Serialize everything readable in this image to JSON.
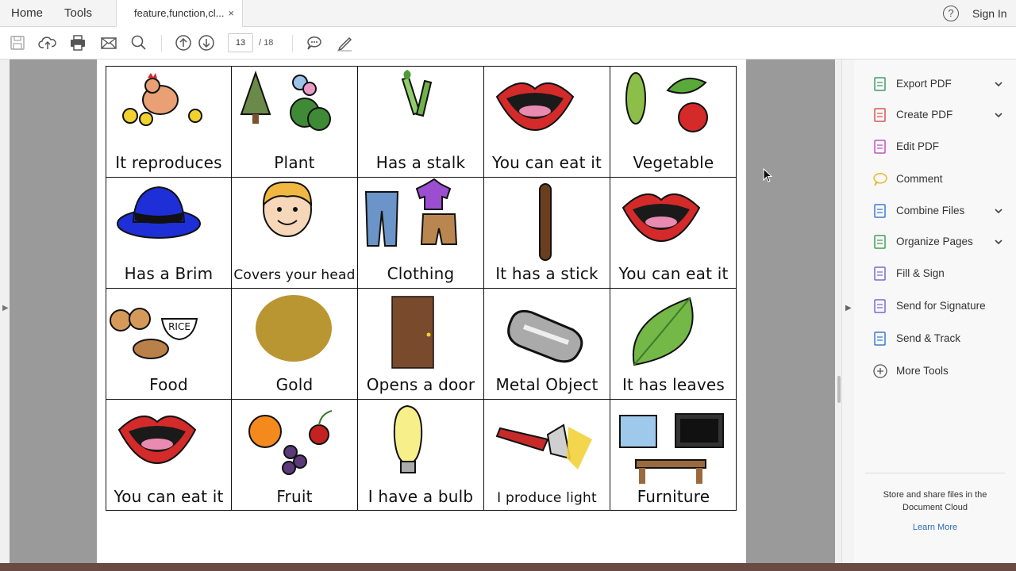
{
  "topbar": {
    "home_label": "Home",
    "tools_label": "Tools",
    "tab_title": "feature,function,cl...",
    "tab_close": "×",
    "help_glyph": "?",
    "signin_label": "Sign In"
  },
  "toolbar": {
    "current_page": "13",
    "total_pages": "/ 18",
    "icons": [
      "save-icon",
      "upload-icon",
      "print-icon",
      "email-icon",
      "search-icon",
      "previous-page-icon",
      "next-page-icon",
      "comment-icon",
      "sign-icon"
    ]
  },
  "cards": [
    {
      "label": "It reproduces",
      "picture": "hen-and-chicks"
    },
    {
      "label": "Plant",
      "picture": "tree-flower-bush"
    },
    {
      "label": "Has a stalk",
      "picture": "celery"
    },
    {
      "label": "You can eat it",
      "picture": "mouth"
    },
    {
      "label": "Vegetable",
      "picture": "corn-peas-tomato"
    },
    {
      "label": "Has a Brim",
      "picture": "blue-hat"
    },
    {
      "label": "Covers your head",
      "picture": "hair"
    },
    {
      "label": "Clothing",
      "picture": "clothes"
    },
    {
      "label": "It has a stick",
      "picture": "stick"
    },
    {
      "label": "You can eat it",
      "picture": "mouth"
    },
    {
      "label": "Food",
      "picture": "cookies-rice-chicken"
    },
    {
      "label": "Gold",
      "picture": "gold-oval"
    },
    {
      "label": "Opens a door",
      "picture": "door"
    },
    {
      "label": "Metal Object",
      "picture": "dog-tags"
    },
    {
      "label": "It has leaves",
      "picture": "leaf"
    },
    {
      "label": "You can eat it",
      "picture": "mouth"
    },
    {
      "label": "Fruit",
      "picture": "orange-grapes-cherry"
    },
    {
      "label": "I have a bulb",
      "picture": "light-bulb"
    },
    {
      "label": "I produce light",
      "picture": "flashlight"
    },
    {
      "label": "Furniture",
      "picture": "chair-tv-table"
    }
  ],
  "rice_text": "RICE",
  "right_panel": {
    "tools": [
      {
        "label": "Export PDF",
        "icon": "export-pdf-icon",
        "color": "#3f9e63"
      },
      {
        "label": "Create PDF",
        "icon": "create-pdf-icon",
        "color": "#d9534f"
      },
      {
        "label": "Edit PDF",
        "icon": "edit-pdf-icon",
        "color": "#c254c1"
      },
      {
        "label": "Comment",
        "icon": "comment-icon",
        "color": "#e8b92e"
      },
      {
        "label": "Combine Files",
        "icon": "combine-files-icon",
        "color": "#3a7bd5"
      },
      {
        "label": "Organize Pages",
        "icon": "organize-pages-icon",
        "color": "#3fa34d"
      },
      {
        "label": "Fill & Sign",
        "icon": "fill-sign-icon",
        "color": "#7b68d6"
      },
      {
        "label": "Send for Signature",
        "icon": "send-signature-icon",
        "color": "#7b68d6"
      },
      {
        "label": "Send & Track",
        "icon": "send-track-icon",
        "color": "#3a7bd5"
      },
      {
        "label": "More Tools",
        "icon": "more-tools-icon",
        "color": "#555555"
      }
    ],
    "store_text": "Store and share files in the Document Cloud",
    "learn_more": "Learn More"
  }
}
